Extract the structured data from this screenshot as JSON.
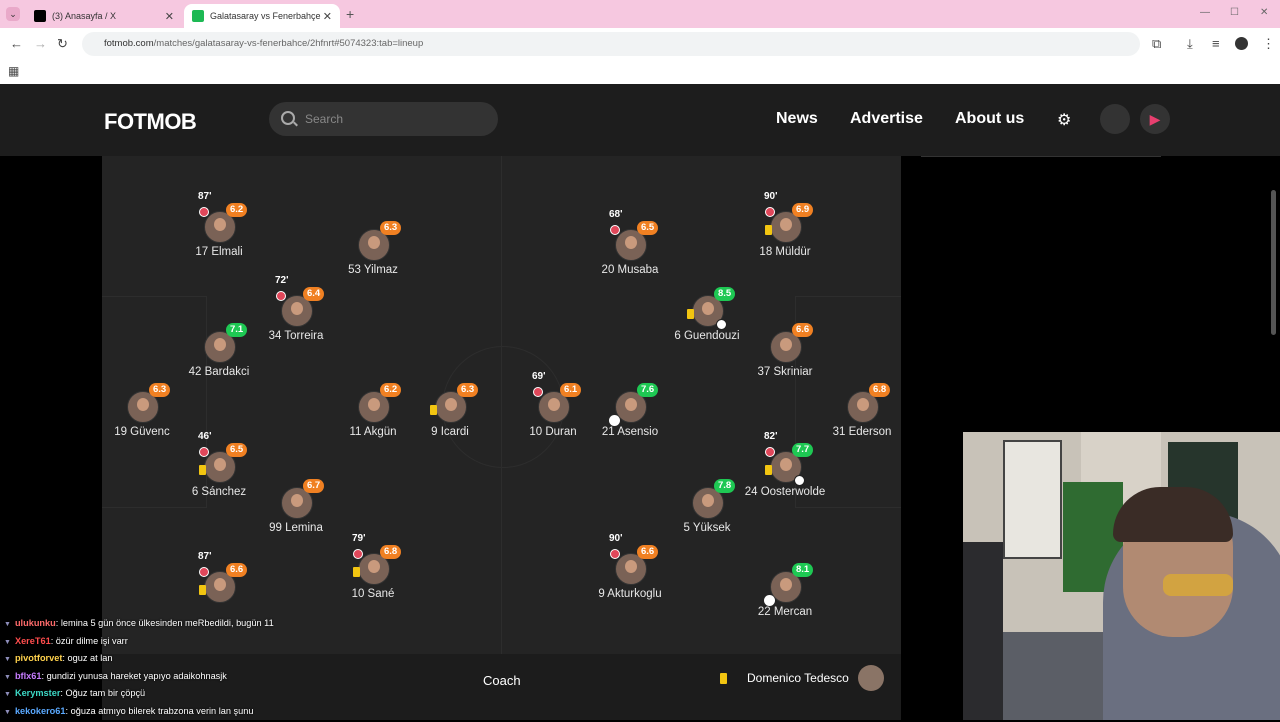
{
  "browser": {
    "tabs": [
      {
        "title": "(3) Anasayfa / X",
        "icon_color": "#000000"
      },
      {
        "title": "Galatasaray vs Fenerbahçe - live",
        "icon_color": "#1db954",
        "active": true
      }
    ],
    "url_host": "fotmob.com",
    "url_path": "/matches/galatasaray-vs-fenerbahce/2hfnrt#5074323:tab=lineup"
  },
  "header": {
    "logo": "FOTMOB",
    "search_placeholder": "Search",
    "nav": [
      "News",
      "Advertise",
      "About us"
    ],
    "icons": [
      "gear-icon",
      "apple-icon",
      "google-play-icon"
    ]
  },
  "players": [
    {
      "id": "p1",
      "name": "17 Elmali",
      "rating": "6.2",
      "rc": "org",
      "minute": "87'",
      "sub": true
    },
    {
      "id": "p2",
      "name": "53 Yilmaz",
      "rating": "6.3",
      "rc": "org"
    },
    {
      "id": "p3",
      "name": "34 Torreira",
      "rating": "6.4",
      "rc": "org",
      "minute": "72'",
      "sub": true
    },
    {
      "id": "p4",
      "name": "42 Bardakci",
      "rating": "7.1",
      "rc": "grn"
    },
    {
      "id": "p5",
      "name": "19 Güvenc",
      "rating": "6.3",
      "rc": "org"
    },
    {
      "id": "p6",
      "name": "11 Akgün",
      "rating": "6.2",
      "rc": "org"
    },
    {
      "id": "p7",
      "name": "9 Icardi",
      "rating": "6.3",
      "rc": "org",
      "card": true
    },
    {
      "id": "p8",
      "name": "6 Sánchez",
      "rating": "6.5",
      "rc": "org",
      "minute": "46'",
      "sub": true,
      "card": true
    },
    {
      "id": "p9",
      "name": "99 Lemina",
      "rating": "6.7",
      "rc": "org"
    },
    {
      "id": "p10",
      "name": "",
      "rating": "6.6",
      "rc": "org",
      "minute": "87'",
      "sub": true,
      "card": true
    },
    {
      "id": "p11",
      "name": "10 Sané",
      "rating": "6.8",
      "rc": "org",
      "minute": "79'",
      "sub": true,
      "card": true
    },
    {
      "id": "p12",
      "name": "20 Musaba",
      "rating": "6.5",
      "rc": "org",
      "minute": "68'",
      "sub": true
    },
    {
      "id": "p13",
      "name": "18 Müldür",
      "rating": "6.9",
      "rc": "org",
      "minute": "90'",
      "sub": true,
      "card": true
    },
    {
      "id": "p14",
      "name": "6 Guendouzi",
      "rating": "8.5",
      "rc": "grn",
      "card": true,
      "ball": true
    },
    {
      "id": "p15",
      "name": "37 Skriniar",
      "rating": "6.6",
      "rc": "org"
    },
    {
      "id": "p16",
      "name": "10 Duran",
      "rating": "6.1",
      "rc": "org",
      "minute": "69'",
      "sub": true
    },
    {
      "id": "p17",
      "name": "21 Asensio",
      "rating": "7.6",
      "rc": "grn",
      "boot": true
    },
    {
      "id": "p18",
      "name": "31 Ederson",
      "rating": "6.8",
      "rc": "org"
    },
    {
      "id": "p19",
      "name": "24 Oosterwolde",
      "rating": "7.7",
      "rc": "grn",
      "minute": "82'",
      "sub": true,
      "card": true,
      "ball": true
    },
    {
      "id": "p20",
      "name": "5 Yüksek",
      "rating": "7.8",
      "rc": "grn"
    },
    {
      "id": "p21",
      "name": "9 Akturkoglu",
      "rating": "6.6",
      "rc": "org",
      "minute": "90'",
      "sub": true
    },
    {
      "id": "p22",
      "name": "22 Mercan",
      "rating": "8.1",
      "rc": "grn",
      "boot": true
    }
  ],
  "coach": {
    "label": "Coach",
    "name": "Domenico Tedesco"
  },
  "chat": [
    {
      "user": "ulukunku",
      "color": "#ff6b6b",
      "msg": ": lemina 5 gün önce ülkesinden meRbedildi, bugün 11"
    },
    {
      "user": "XereT61",
      "color": "#ff4d4d",
      "msg": ": özür dilme işi varr"
    },
    {
      "user": "pivotforvet",
      "color": "#ffd24d",
      "msg": ": oguz at lan"
    },
    {
      "user": "bflx61",
      "color": "#c77dff",
      "msg": ": gundizi yunusa hareket yapıyo adaikohnasjk"
    },
    {
      "user": "Kerymster",
      "color": "#3dd8c6",
      "msg": ": Oğuz tam bir çöpçü"
    },
    {
      "user": "kekokero61",
      "color": "#5aa9ff",
      "msg": ": oğuza atmıyo bilerek trabzona verin lan şunu"
    }
  ]
}
